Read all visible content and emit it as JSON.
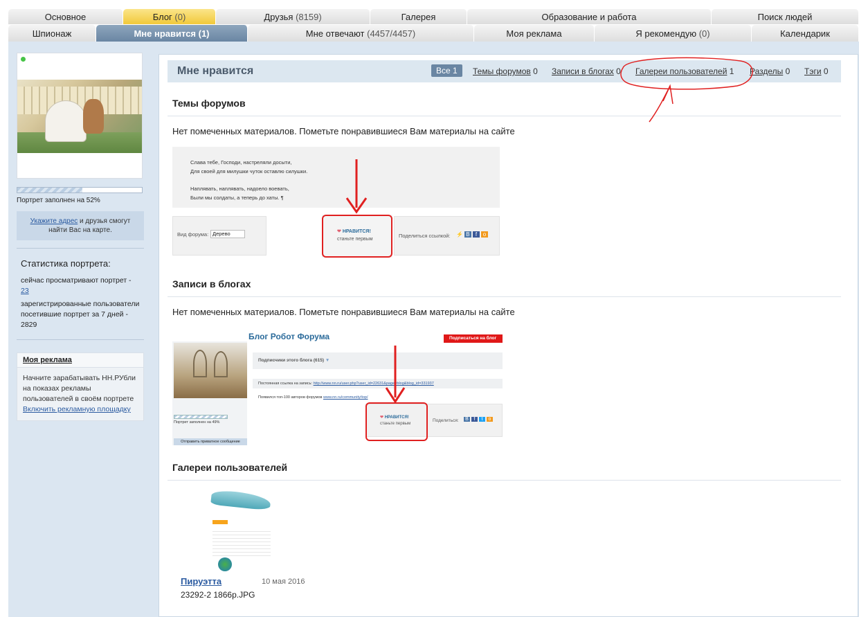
{
  "tabs_row1": [
    {
      "label": "Основное",
      "count": ""
    },
    {
      "label": "Блог",
      "count": " (0)"
    },
    {
      "label": "Друзья",
      "count": " (8159)"
    },
    {
      "label": "Галерея",
      "count": ""
    },
    {
      "label": "Образование и работа",
      "count": ""
    },
    {
      "label": "Поиск людей",
      "count": ""
    }
  ],
  "tabs_row2": [
    {
      "label": "Шпионаж",
      "count": ""
    },
    {
      "label": "Мне нравится",
      "count": " (1)"
    },
    {
      "label": "Мне отвечают",
      "count": " (4457/4457)"
    },
    {
      "label": "Моя реклама",
      "count": ""
    },
    {
      "label": "Я рекомендую",
      "count": " (0)"
    },
    {
      "label": "Календарик",
      "count": ""
    }
  ],
  "sidebar": {
    "portrait_progress": 0.52,
    "portrait_filled": "Портрет заполнен на 52%",
    "map_link": "Укажите адрес",
    "map_text": " и друзья смогут найти Вас на карте.",
    "stats_title": "Статистика портрета:",
    "stats_now": "сейчас просматривают портрет -",
    "stats_now_count": "23",
    "stats_week": "зарегистрированные пользователи посетившие портрет за 7 дней - 2829",
    "ad_title": "Моя реклама",
    "ad_text": "Начните зарабатывать НН.РУбли на показах рекламы пользователей в своём портрете",
    "ad_link": "Включить рекламную площадку"
  },
  "main": {
    "title": "Мне нравится",
    "filters": {
      "all": "Все 1",
      "forums": "Темы форумов",
      "forums_n": " 0",
      "blogs": "Записи в блогах",
      "blogs_n": " 0",
      "galleries": "Галереи пользователей",
      "galleries_n": " 1",
      "sections": "Разделы",
      "sections_n": " 0",
      "tags": "Тэги",
      "tags_n": " 0"
    },
    "section_forums": "Темы форумов",
    "section_blogs": "Записи в блогах",
    "section_gallery": "Галереи пользователей",
    "empty_msg": "Нет помеченных материалов. Пометьте понравившиеся Вам материалы на сайте",
    "forum_shot": {
      "line1": "Слава тебе, Господи, настреляли досыти,",
      "line2": "Для своей для милушки чуток оставлю силушки.",
      "line3": "Наплявать, наплявать, надоело воевать,",
      "line4": "Были мы солдаты, а теперь до хаты. ¶",
      "view_label": "Вид форума:",
      "view_value": "Дерево",
      "like": "НРАВИТСЯ!",
      "like_sub": "станьте первым",
      "share": "Поделиться ссылкой:"
    },
    "blog_shot": {
      "title": "Блог Робот Форума",
      "subscribe": "Подписаться на блог",
      "subscribers": "Подписчики этого блога (615)",
      "permalink_label": "Постоянная ссылка на запись:",
      "permalink": "http://www.nn.ru/user.php?user_id=22631&page=blog&blog_id=331937",
      "top100": "Появился топ-100 авторов форумов",
      "top100_link": "www.nn.ru/community/top/",
      "portrait": "Портрет заполнен на 49%",
      "send_msg": "Отправить приватное сообщение",
      "like": "НРАВИТСЯ!",
      "like_sub": "станьте первым",
      "share": "Поделиться:"
    },
    "gallery_item": {
      "author": "Пируэтта",
      "date": "10 мая 2016",
      "file": "23292-2 1866р.JPG"
    }
  },
  "colors": {
    "accent": "#6a86a3",
    "annotation": "#e02020",
    "tab_yellow": "#f1c93a"
  }
}
